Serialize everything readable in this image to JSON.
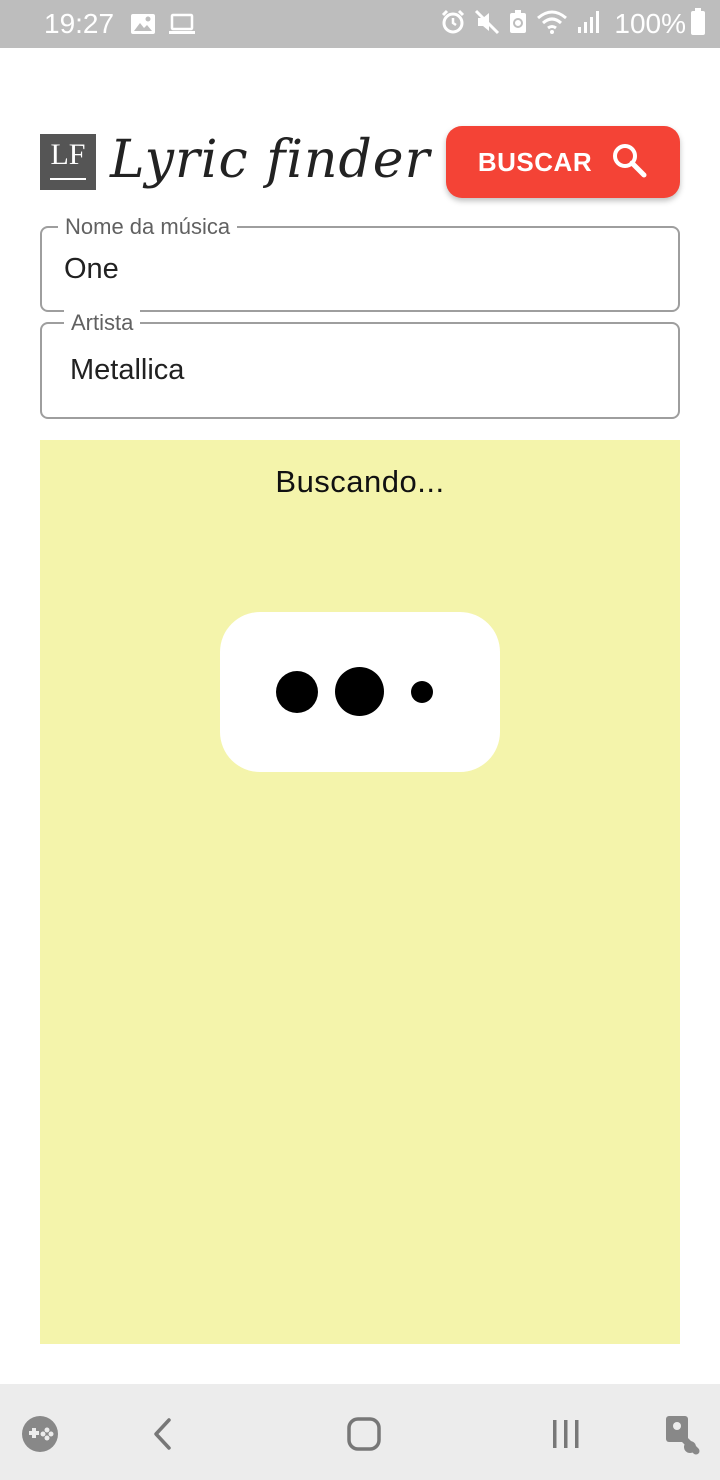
{
  "status_bar": {
    "time": "19:27",
    "battery": "100%",
    "left_icons": [
      "image-icon",
      "laptop-icon"
    ],
    "right_icons": [
      "alarm-icon",
      "mute-icon",
      "battery-saver-icon",
      "wifi-icon",
      "signal-icon",
      "battery-icon"
    ]
  },
  "header": {
    "logo_text": "LF",
    "title": "Lyric finder",
    "search_button_label": "BUSCAR",
    "search_icon": "search-icon"
  },
  "form": {
    "song": {
      "label": "Nome da música",
      "value": "One"
    },
    "artist": {
      "label": "Artista",
      "value": "Metallica"
    }
  },
  "results": {
    "status_text": "Buscando...",
    "loader_icon": "typing-dots-icon"
  },
  "nav_bar": {
    "items": [
      "game-launcher-icon",
      "back-icon",
      "home-icon",
      "recents-icon",
      "accessibility-icon"
    ]
  },
  "colors": {
    "accent": "#f44336",
    "panel_background": "#f4f4ab",
    "logo_background": "#555555",
    "status_bar": "#bdbdbd",
    "nav_bar": "#ececec"
  }
}
